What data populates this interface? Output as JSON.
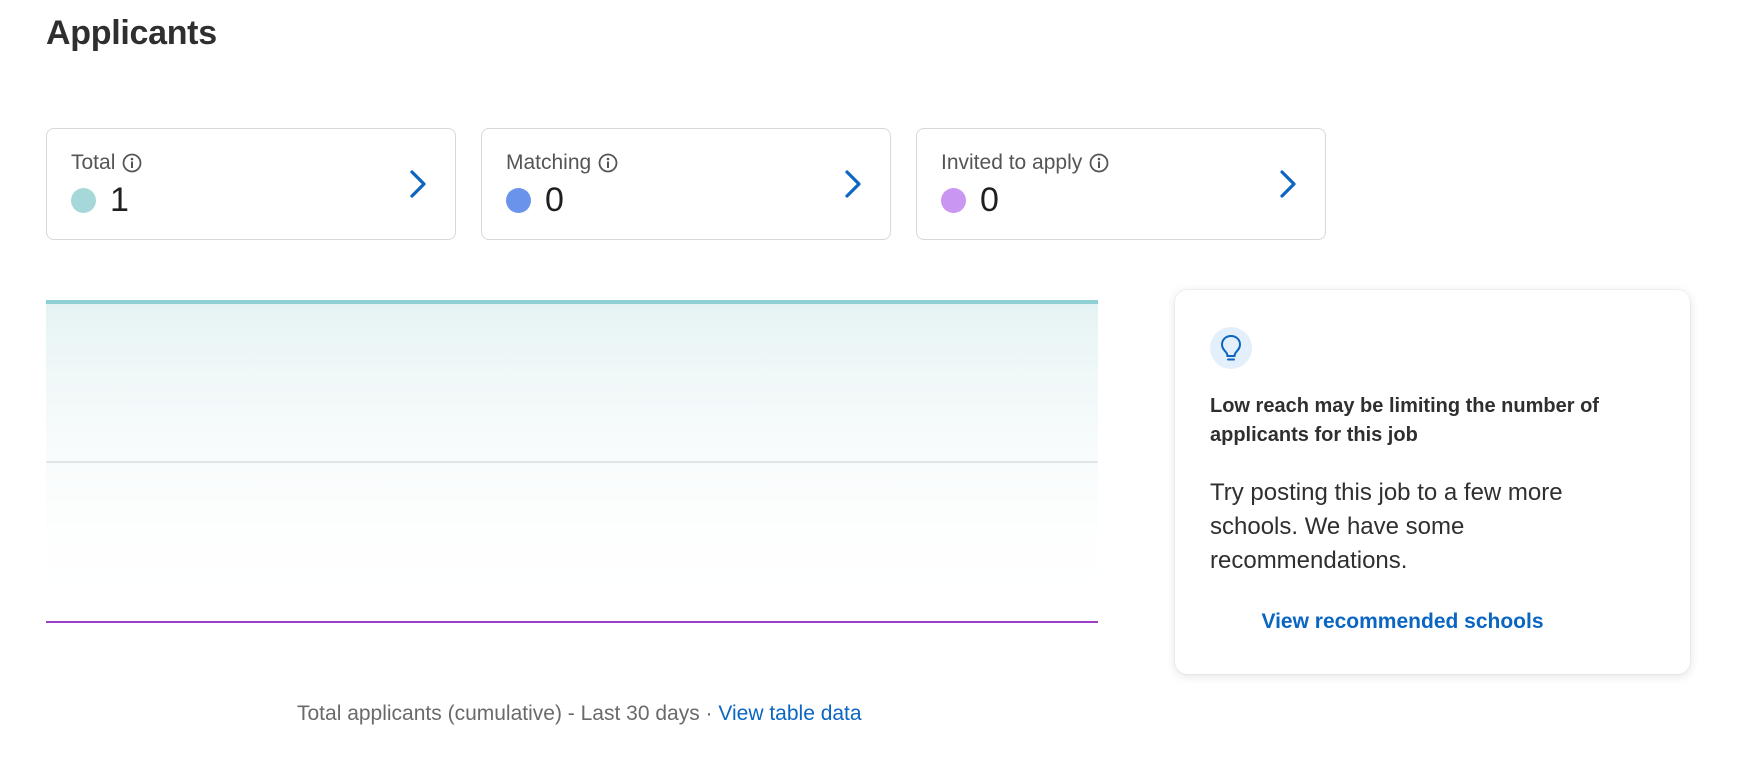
{
  "page": {
    "title": "Applicants"
  },
  "stats": [
    {
      "label": "Total",
      "value": "1",
      "color": "#a6d8da",
      "info_icon": "info-icon",
      "chevron_icon": "chevron-right-icon"
    },
    {
      "label": "Matching",
      "value": "0",
      "color": "#6a93eb",
      "info_icon": "info-icon",
      "chevron_icon": "chevron-right-icon"
    },
    {
      "label": "Invited to apply",
      "value": "0",
      "color": "#c996f2",
      "info_icon": "info-icon",
      "chevron_icon": "chevron-right-icon"
    }
  ],
  "chart_data": {
    "type": "area",
    "title": "",
    "xlabel": "",
    "ylabel": "",
    "ylim": [
      0,
      1
    ],
    "y_ticks": [
      "1",
      "0.5"
    ],
    "y_axis_position": "right",
    "grid": true,
    "series": [
      {
        "name": "Total",
        "values": [
          1,
          1
        ],
        "color": "#8ecfd4"
      },
      {
        "name": "Matching",
        "values": [
          0,
          0
        ],
        "color": "#6a93eb"
      },
      {
        "name": "Invited to apply",
        "values": [
          0,
          0
        ],
        "color": "#9b3fc9"
      }
    ]
  },
  "caption": {
    "text": "Total applicants (cumulative) - Last 30 days · ",
    "link": "View table data"
  },
  "tip": {
    "icon": "lightbulb-icon",
    "heading": "Low reach may be limiting the number of applicants for this job",
    "body": "Try posting this job to a few more schools. We have some recommendations.",
    "link": "View recommended schools",
    "accent": "#0a66c2"
  }
}
